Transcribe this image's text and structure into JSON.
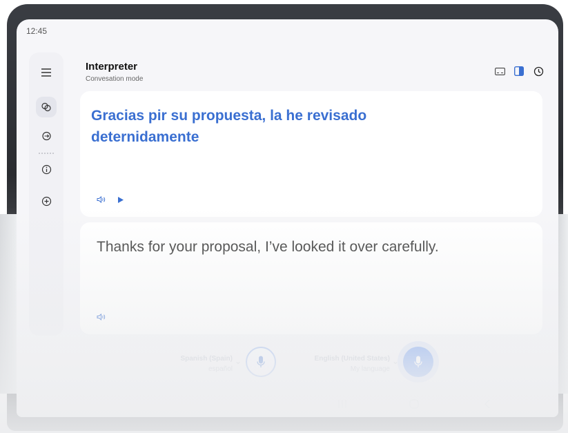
{
  "status_bar": {
    "time": "12:45"
  },
  "header": {
    "title": "Interpreter",
    "subtitle": "Convesation mode"
  },
  "sidebar": {
    "items": [
      {
        "icon": "menu-icon"
      },
      {
        "icon": "conversation-icon",
        "active": true
      },
      {
        "icon": "chat-bubble-icon"
      },
      {
        "icon": "info-icon"
      },
      {
        "icon": "add-circle-icon"
      }
    ]
  },
  "top_actions": [
    "dual-screen-icon",
    "split-view-icon",
    "history-icon"
  ],
  "source_card": {
    "text": "Gracias pir su propuesta, la he revisado deternidamente",
    "controls": [
      "speaker-icon",
      "play-icon"
    ]
  },
  "target_card": {
    "text": "Thanks for your proposal, I’ve looked it over carefully.",
    "controls": [
      "speaker-icon"
    ]
  },
  "languages": {
    "left": {
      "name": "Spanish (Spain)",
      "native": "español"
    },
    "right": {
      "name": "English (United States)",
      "native": "My language"
    }
  },
  "colors": {
    "accent": "#3a6fd1",
    "mic_active": "#5b8ef0",
    "screen_bg": "#f6f6f9"
  },
  "nav_bar": [
    "recent-apps-icon",
    "home-icon",
    "back-icon"
  ]
}
